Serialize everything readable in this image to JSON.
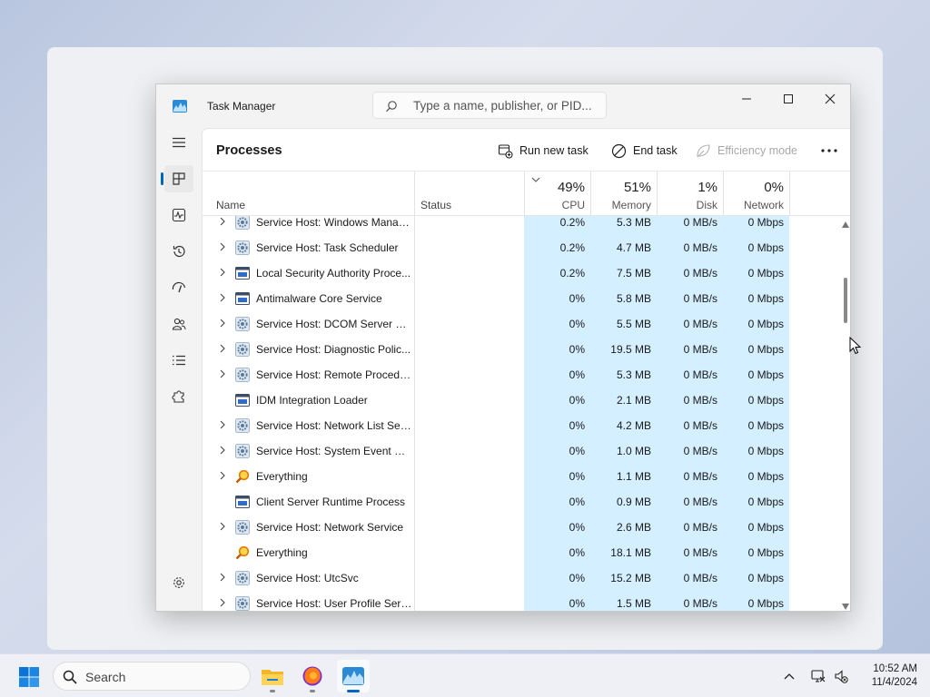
{
  "window": {
    "title": "Task Manager",
    "search_placeholder": "Type a name, publisher, or PID..."
  },
  "toolbar": {
    "page_title": "Processes",
    "run_new_task": "Run new task",
    "end_task": "End task",
    "efficiency_mode": "Efficiency mode"
  },
  "columns": {
    "name": "Name",
    "status": "Status",
    "cpu": {
      "pct": "49%",
      "label": "CPU"
    },
    "memory": {
      "pct": "51%",
      "label": "Memory"
    },
    "disk": {
      "pct": "1%",
      "label": "Disk"
    },
    "network": {
      "pct": "0%",
      "label": "Network"
    }
  },
  "processes": [
    {
      "name": "Service Host: Windows Manag...",
      "icon": "gear-icon",
      "expandable": true,
      "cpu": "0.2%",
      "memory": "5.3 MB",
      "disk": "0 MB/s",
      "network": "0 Mbps"
    },
    {
      "name": "Service Host: Task Scheduler",
      "icon": "gear-icon",
      "expandable": true,
      "cpu": "0.2%",
      "memory": "4.7 MB",
      "disk": "0 MB/s",
      "network": "0 Mbps"
    },
    {
      "name": "Local Security Authority Proce...",
      "icon": "window-icon",
      "expandable": true,
      "cpu": "0.2%",
      "memory": "7.5 MB",
      "disk": "0 MB/s",
      "network": "0 Mbps"
    },
    {
      "name": "Antimalware Core Service",
      "icon": "window-icon",
      "expandable": true,
      "cpu": "0%",
      "memory": "5.8 MB",
      "disk": "0 MB/s",
      "network": "0 Mbps"
    },
    {
      "name": "Service Host: DCOM Server Pr...",
      "icon": "gear-icon",
      "expandable": true,
      "cpu": "0%",
      "memory": "5.5 MB",
      "disk": "0 MB/s",
      "network": "0 Mbps"
    },
    {
      "name": "Service Host: Diagnostic Polic...",
      "icon": "gear-icon",
      "expandable": true,
      "cpu": "0%",
      "memory": "19.5 MB",
      "disk": "0 MB/s",
      "network": "0 Mbps"
    },
    {
      "name": "Service Host: Remote Procedu...",
      "icon": "gear-icon",
      "expandable": true,
      "cpu": "0%",
      "memory": "5.3 MB",
      "disk": "0 MB/s",
      "network": "0 Mbps"
    },
    {
      "name": "IDM Integration Loader",
      "icon": "window-icon",
      "expandable": false,
      "cpu": "0%",
      "memory": "2.1 MB",
      "disk": "0 MB/s",
      "network": "0 Mbps"
    },
    {
      "name": "Service Host: Network List Ser...",
      "icon": "gear-icon",
      "expandable": true,
      "cpu": "0%",
      "memory": "4.2 MB",
      "disk": "0 MB/s",
      "network": "0 Mbps"
    },
    {
      "name": "Service Host: System Event No...",
      "icon": "gear-icon",
      "expandable": true,
      "cpu": "0%",
      "memory": "1.0 MB",
      "disk": "0 MB/s",
      "network": "0 Mbps"
    },
    {
      "name": "Everything",
      "icon": "magnifier-icon",
      "expandable": true,
      "cpu": "0%",
      "memory": "1.1 MB",
      "disk": "0 MB/s",
      "network": "0 Mbps"
    },
    {
      "name": "Client Server Runtime Process",
      "icon": "window-icon",
      "expandable": false,
      "cpu": "0%",
      "memory": "0.9 MB",
      "disk": "0 MB/s",
      "network": "0 Mbps"
    },
    {
      "name": "Service Host: Network Service",
      "icon": "gear-icon",
      "expandable": true,
      "cpu": "0%",
      "memory": "2.6 MB",
      "disk": "0 MB/s",
      "network": "0 Mbps"
    },
    {
      "name": "Everything",
      "icon": "magnifier-icon",
      "expandable": false,
      "cpu": "0%",
      "memory": "18.1 MB",
      "disk": "0 MB/s",
      "network": "0 Mbps"
    },
    {
      "name": "Service Host: UtcSvc",
      "icon": "gear-icon",
      "expandable": true,
      "cpu": "0%",
      "memory": "15.2 MB",
      "disk": "0 MB/s",
      "network": "0 Mbps"
    },
    {
      "name": "Service Host: User Profile Servi...",
      "icon": "gear-icon",
      "expandable": true,
      "cpu": "0%",
      "memory": "1.5 MB",
      "disk": "0 MB/s",
      "network": "0 Mbps"
    }
  ],
  "taskbar": {
    "search_label": "Search",
    "time": "10:52 AM",
    "date": "11/4/2024"
  },
  "colors": {
    "accent": "#0067c0",
    "heat": "#d4efff"
  }
}
